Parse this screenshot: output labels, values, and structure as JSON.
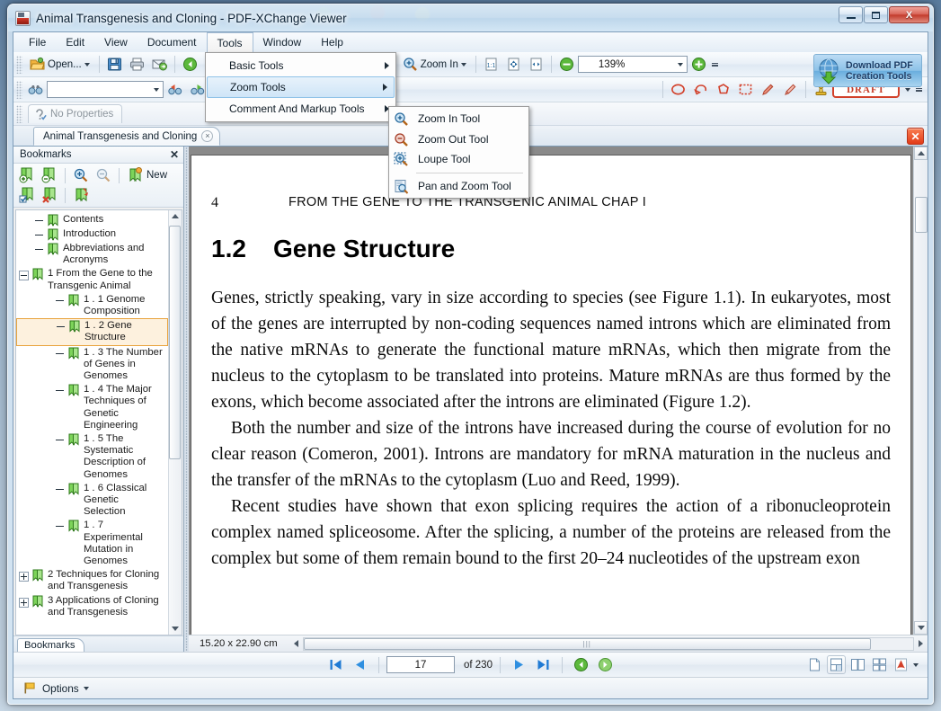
{
  "window": {
    "title": "Animal Transgenesis and Cloning - PDF-XChange Viewer",
    "minimize_label": "Minimize",
    "maximize_label": "Maximize",
    "close_label": "X"
  },
  "menubar": {
    "items": [
      {
        "label": "File"
      },
      {
        "label": "Edit"
      },
      {
        "label": "View"
      },
      {
        "label": "Document"
      },
      {
        "label": "Tools",
        "open": true
      },
      {
        "label": "Window"
      },
      {
        "label": "Help"
      }
    ]
  },
  "tools_menu": {
    "items": [
      {
        "label": "Basic Tools",
        "submenu": true,
        "highlighted": false
      },
      {
        "label": "Zoom Tools",
        "submenu": true,
        "highlighted": true
      },
      {
        "label": "Comment And Markup Tools",
        "submenu": true,
        "highlighted": false
      }
    ]
  },
  "zoom_submenu": {
    "items": [
      {
        "label": "Zoom In Tool",
        "icon": "zoom-in-icon"
      },
      {
        "label": "Zoom Out Tool",
        "icon": "zoom-out-icon"
      },
      {
        "label": "Loupe Tool",
        "icon": "loupe-icon"
      },
      {
        "separator_after": true
      },
      {
        "label": "Pan and Zoom Tool",
        "icon": "pan-zoom-icon"
      }
    ]
  },
  "toolbar": {
    "open_label": "Open...",
    "save_icon": "save-icon",
    "print_icon": "print-icon",
    "email_icon": "email-icon",
    "back_icon": "back-arrow-icon",
    "forward_icon": "forward-arrow-icon",
    "zoom_tool_label": "Zoom In",
    "fit_actual_icon": "actual-size-icon",
    "fit_page_icon": "fit-page-icon",
    "fit_width_icon": "fit-width-icon",
    "zoom_out_icon": "zoom-out-minus-icon",
    "zoom_level": "139%",
    "zoom_in_icon": "zoom-in-plus-icon",
    "search_placeholder": "",
    "search_value": "",
    "stamp_label": "DRAFT",
    "stamp_icon": "stamp-icon"
  },
  "properties_bar": {
    "label": "No Properties",
    "icon": "properties-icon"
  },
  "download_banner": {
    "line1": "Download PDF",
    "line2": "Creation Tools",
    "icon": "globe-download-icon"
  },
  "document_tab": {
    "label": "Animal Transgenesis and Cloning",
    "close_label": "×",
    "window_close_label": "✕"
  },
  "sidebar": {
    "header_title": "Bookmarks",
    "header_close": "✕",
    "new_label": "New",
    "footer_tab": "Bookmarks",
    "tools": [
      {
        "name": "add-bookmark-icon"
      },
      {
        "name": "remove-bookmark-icon"
      },
      {
        "name": "expand-bookmarks-icon"
      },
      {
        "name": "collapse-bookmarks-icon"
      },
      {
        "name": "new-bookmark-icon"
      },
      {
        "name": "bookmark-properties-icon"
      },
      {
        "name": "delete-bookmark-icon"
      },
      {
        "name": "goto-bookmark-icon"
      }
    ],
    "bookmarks": [
      {
        "label": "Contents",
        "level": 1,
        "expander": "none",
        "selected": false
      },
      {
        "label": "Introduction",
        "level": 1,
        "expander": "none",
        "selected": false
      },
      {
        "label": "Abbreviations and Acronyms",
        "level": 1,
        "expander": "none",
        "selected": false
      },
      {
        "label": "1 From the Gene to the Transgenic Animal",
        "level": 0,
        "expander": "minus",
        "selected": false
      },
      {
        "label": "1 . 1 Genome Composition",
        "level": 2,
        "expander": "none",
        "selected": false
      },
      {
        "label": "1 . 2 Gene Structure",
        "level": 2,
        "expander": "none",
        "selected": true
      },
      {
        "label": "1 . 3 The Number of Genes in Genomes",
        "level": 2,
        "expander": "none",
        "selected": false
      },
      {
        "label": "1 . 4 The Major Techniques of Genetic Engineering",
        "level": 2,
        "expander": "none",
        "selected": false
      },
      {
        "label": "1 . 5 The Systematic Description of Genomes",
        "level": 2,
        "expander": "none",
        "selected": false
      },
      {
        "label": "1 . 6 Classical Genetic Selection",
        "level": 2,
        "expander": "none",
        "selected": false
      },
      {
        "label": "1 . 7 Experimental Mutation in Genomes",
        "level": 2,
        "expander": "none",
        "selected": false
      },
      {
        "label": "2 Techniques for Cloning and Transgenesis",
        "level": 0,
        "expander": "plus",
        "selected": false
      },
      {
        "label": "3 Applications of Cloning and Transgenesis",
        "level": 0,
        "expander": "plus",
        "selected": false
      }
    ]
  },
  "page": {
    "header_number": "4",
    "header_title": "FROM THE GENE TO THE TRANSGENIC ANIMAL   CHAP I",
    "section_number": "1.2",
    "section_title": "Gene Structure",
    "paragraphs": [
      "Genes, strictly speaking, vary in size according to species (see Figure 1.1). In eukaryotes, most of the genes are interrupted by non-coding sequences named introns which are eliminated from the native mRNAs to generate the functional mature mRNAs, which then migrate from the nucleus to the cytoplasm to be translated into proteins. Mature mRNAs are thus formed by the exons, which become associated after the introns are eliminated (Figure 1.2).",
      "Both the number and size of the introns have increased during the course of evolution for no clear reason (Comeron, 2001). Introns are mandatory for mRNA maturation in the nucleus and the transfer of the mRNAs to the cytoplasm (Luo and Reed, 1999).",
      "Recent studies have shown that exon splicing requires the action of a ribonucleoprotein complex named spliceosome. After the splicing, a number of the proteins are released from the complex but some of them remain bound to the first 20–24 nucleotides of the upstream exon"
    ]
  },
  "status": {
    "page_size": "15.20 x 22.90 cm",
    "current_page": "17",
    "total_pages": "of 230",
    "first_page_icon": "first-page-icon",
    "prev_page_icon": "prev-page-icon",
    "next_page_icon": "next-page-icon",
    "last_page_icon": "last-page-icon",
    "back_view_icon": "back-view-icon",
    "forward_view_icon": "forward-view-icon",
    "view_modes": [
      {
        "name": "single-page-icon",
        "active": false
      },
      {
        "name": "continuous-icon",
        "active": true
      },
      {
        "name": "two-page-icon",
        "active": false
      },
      {
        "name": "two-page-continuous-icon",
        "active": false
      },
      {
        "name": "adobe-pdf-icon",
        "active": false
      }
    ]
  },
  "options": {
    "label": "Options",
    "icon": "flag-icon"
  },
  "colors": {
    "accent_blue": "#2a7fd4",
    "selection_orange": "#e8a33d",
    "draft_red": "#c63b26",
    "title_text": "#0b2033"
  }
}
